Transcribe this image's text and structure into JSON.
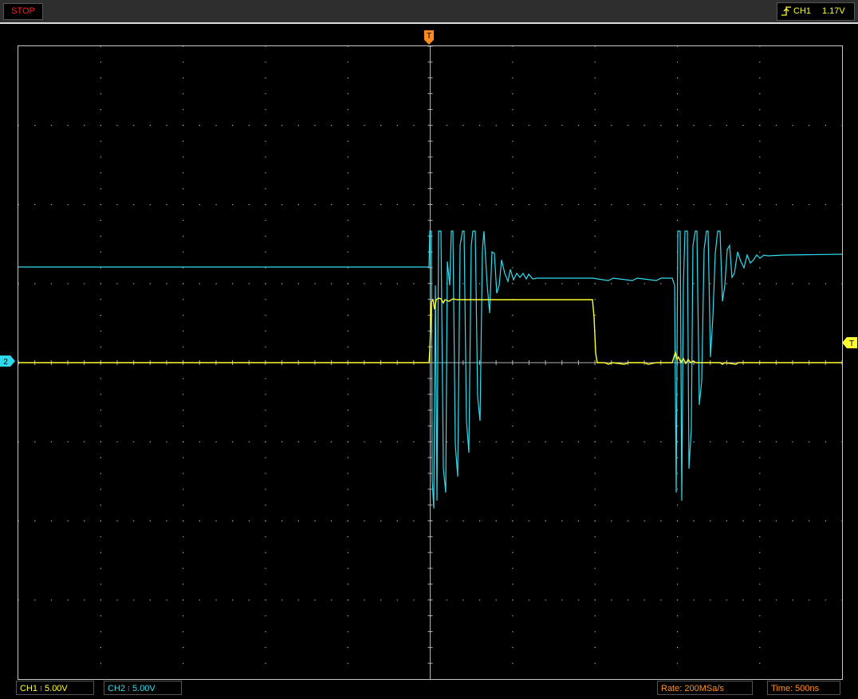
{
  "status": {
    "label": "STOP",
    "color": "#ff2020"
  },
  "trigger": {
    "channel": "CH1",
    "level": "1.17V",
    "edge_icon": "rising-edge-icon",
    "position_marker": "T",
    "level_marker": "T",
    "color": "#ffff30"
  },
  "channels": [
    {
      "id": "CH1",
      "label": "CH1",
      "coupling_icon": "dc-coupling-icon",
      "scale": "5.00V",
      "color": "#ffff30"
    },
    {
      "id": "CH2",
      "label": "CH2",
      "coupling_icon": "dc-coupling-icon",
      "scale": "5.00V",
      "color": "#30e0f0",
      "marker": "2"
    }
  ],
  "acquisition": {
    "rate_label": "Rate:",
    "rate": "200MSa/s",
    "time_label": "Time:",
    "timebase": "500ns"
  },
  "colors": {
    "grid": "#c8c8c8",
    "background": "#000000",
    "accent": "#ff9020"
  }
}
